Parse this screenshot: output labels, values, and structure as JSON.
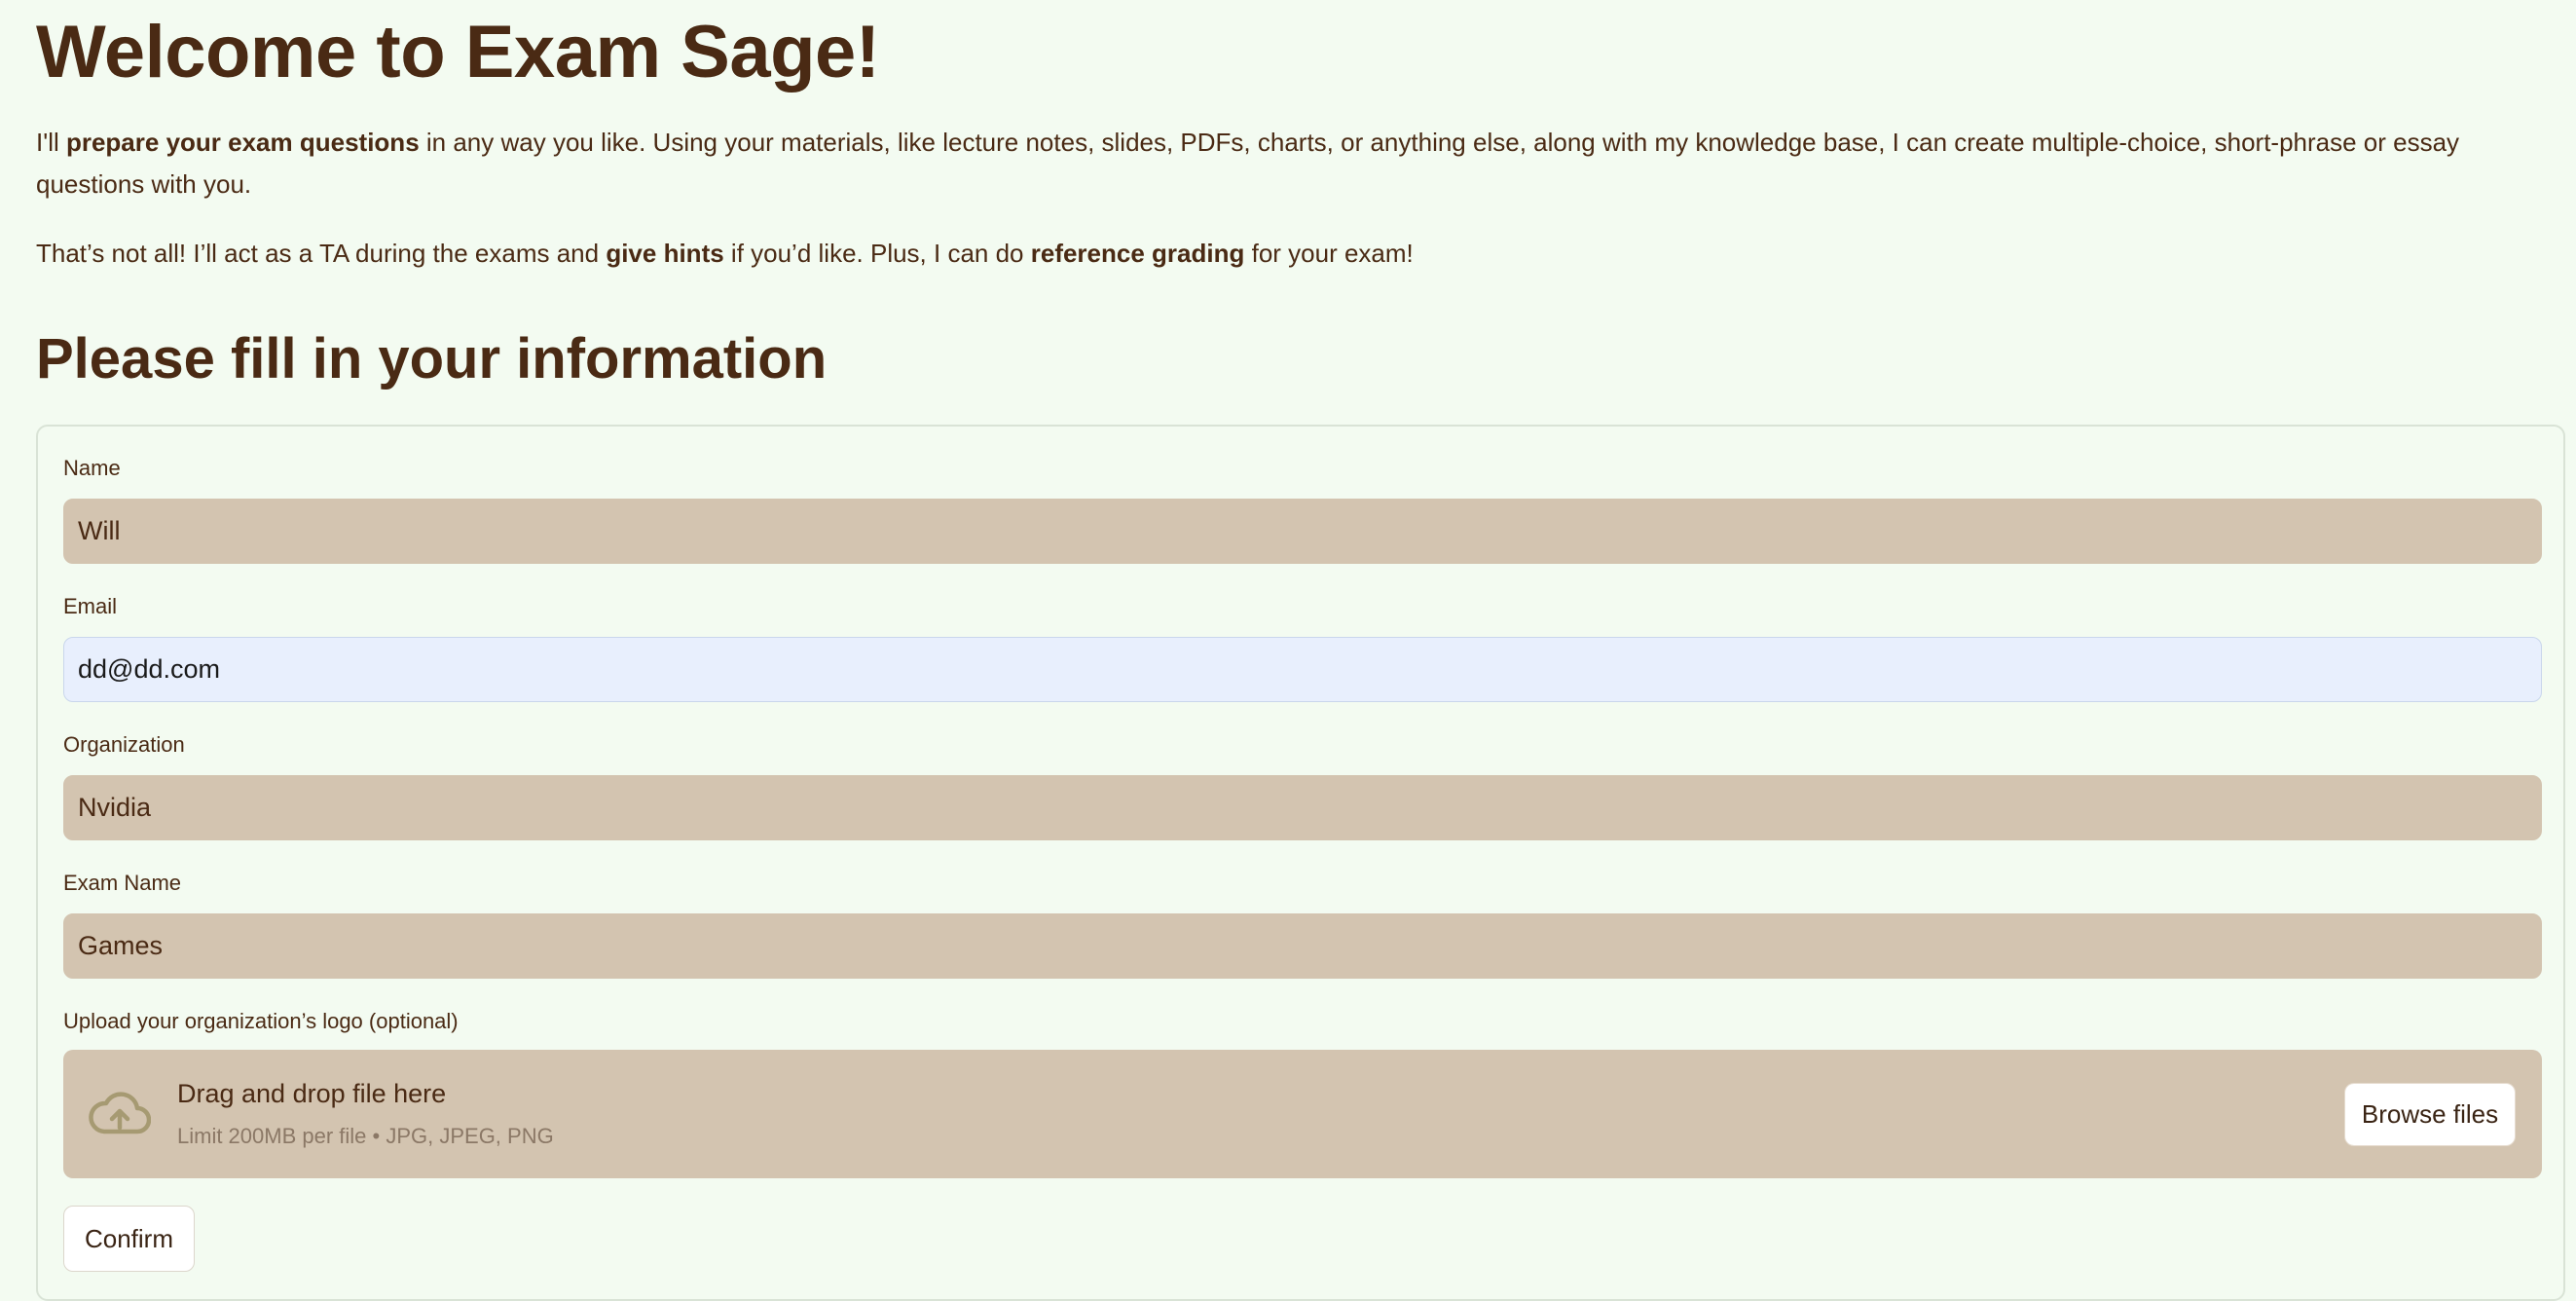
{
  "header": {
    "title": "Welcome to Exam Sage!"
  },
  "intro": {
    "p1_part1": "I'll ",
    "p1_bold1": "prepare your exam questions",
    "p1_part2": " in any way you like. Using your materials, like lecture notes, slides, PDFs, charts, or anything else, along with my knowledge base, I can create multiple-choice, short-phrase or essay questions with you.",
    "p2_part1": "That’s not all! I’ll act as a TA during the exams and ",
    "p2_bold1": "give hints",
    "p2_part2": " if you’d like. Plus, I can do ",
    "p2_bold2": "reference grading",
    "p2_part3": " for your exam!"
  },
  "form": {
    "heading": "Please fill in your information",
    "name": {
      "label": "Name",
      "value": "Will"
    },
    "email": {
      "label": "Email",
      "value": "dd@dd.com"
    },
    "organization": {
      "label": "Organization",
      "value": "Nvidia"
    },
    "exam_name": {
      "label": "Exam Name",
      "value": "Games"
    },
    "upload": {
      "label": "Upload your organization’s logo (optional)",
      "title": "Drag and drop file here",
      "limit": "Limit 200MB per file • JPG, JPEG, PNG",
      "icon": "cloud-upload-icon",
      "browse_label": "Browse files"
    },
    "confirm_label": "Confirm"
  },
  "colors": {
    "background": "#f3fbf1",
    "text": "#4a2a14",
    "input_bg": "#d3c4b0",
    "email_bg": "#e8effd"
  }
}
